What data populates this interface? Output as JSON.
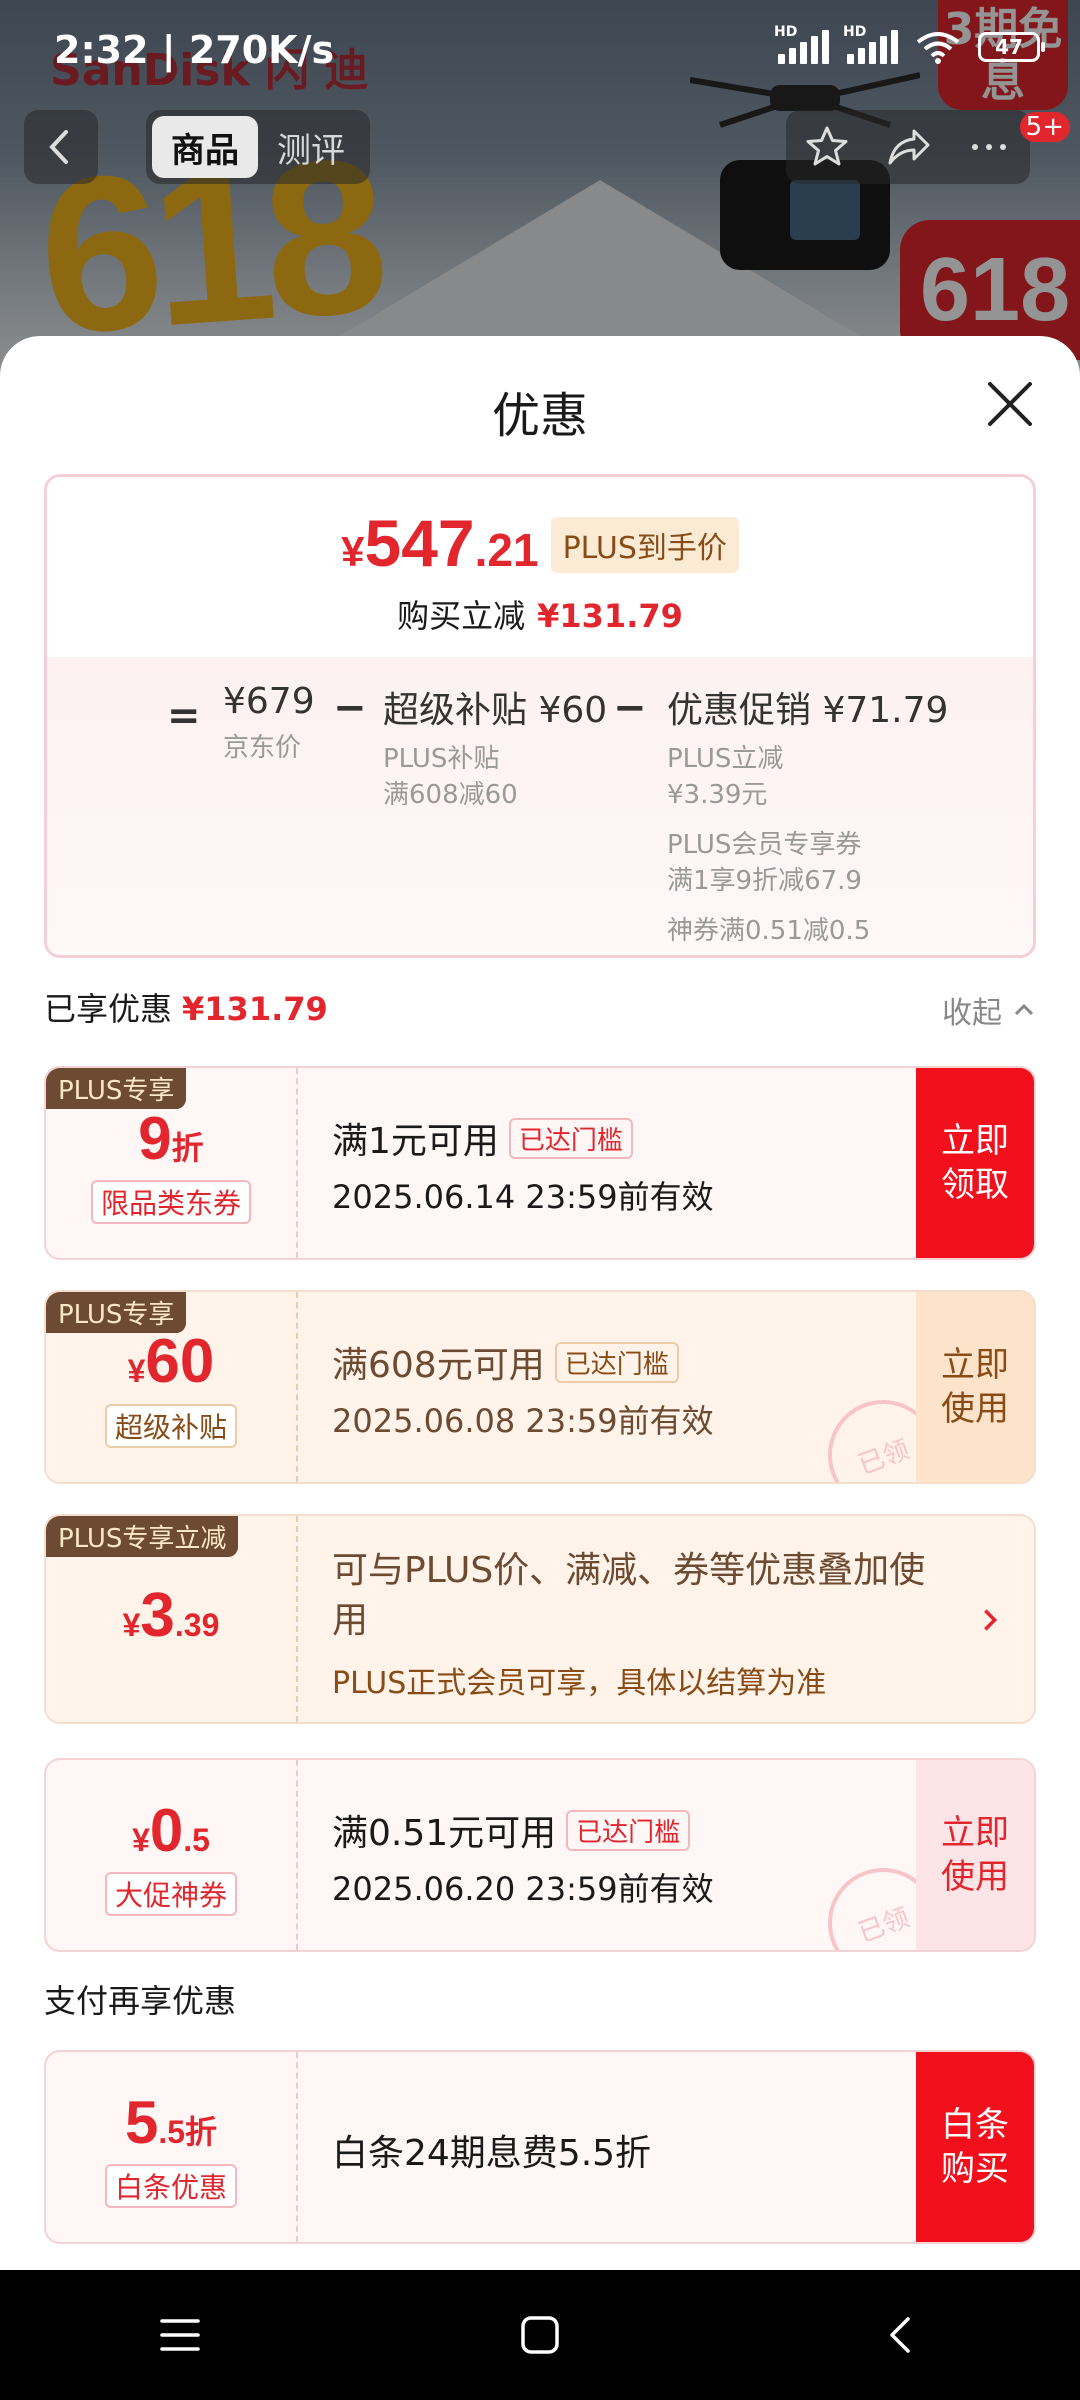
{
  "status_bar": {
    "time": "2:32 | 270K/s",
    "battery": "47",
    "signal_hd": "HD"
  },
  "background": {
    "brand_text": "SanDisk 闪 迪",
    "promo_badge": "3期免息",
    "promo_618": "618",
    "nav_count": "5+"
  },
  "nav": {
    "tabs": [
      "商品",
      "测评"
    ]
  },
  "sheet": {
    "title": "优惠",
    "summary": {
      "price_currency": "¥",
      "price_int": "547",
      "price_dec": ".21",
      "plus_tag": "PLUS到手价",
      "save_label": "购买立减",
      "save_amount": "¥131.79",
      "eq": "=",
      "minus": "−",
      "jd_price": "¥679",
      "jd_label": "京东价",
      "subsidy_title": "超级补贴 ¥60",
      "subsidy_line1": "PLUS补贴",
      "subsidy_line2": "满608减60",
      "promo_title": "优惠促销 ¥71.79",
      "promo_lines": [
        "PLUS立减",
        "¥3.39元",
        "PLUS会员专享券",
        "满1享9折减67.9",
        "神券满0.51减0.5"
      ]
    },
    "enjoyed_label": "已享优惠",
    "enjoyed_amount": "¥131.79",
    "collapse_label": "收起",
    "coupons": [
      {
        "tag": "PLUS专享",
        "big": "9",
        "big_suffix": "折",
        "sub": "限品类东券",
        "cond": "满1元可用",
        "met": "已达门槛",
        "expiry": "2025.06.14 23:59前有效",
        "action": "立即\n领取"
      },
      {
        "tag": "PLUS专享",
        "big_prefix": "¥",
        "big": "60",
        "sub": "超级补贴",
        "cond": "满608元可用",
        "met": "已达门槛",
        "expiry": "2025.06.08 23:59前有效",
        "action": "立即\n使用",
        "stamp": "已领"
      },
      {
        "tag": "PLUS专享立减",
        "big_prefix": "¥",
        "big": "3",
        "big_suffix": ".39",
        "desc": "可与PLUS价、满减、券等优惠叠加使用",
        "note": "PLUS正式会员可享，具体以结算为准"
      },
      {
        "big_prefix": "¥",
        "big": "0",
        "big_suffix": ".5",
        "sub": "大促神券",
        "cond": "满0.51元可用",
        "met": "已达门槛",
        "expiry": "2025.06.20 23:59前有效",
        "action": "立即\n使用",
        "stamp": "已领"
      }
    ],
    "pay_title": "支付再享优惠",
    "pay_coupon": {
      "big": "5",
      "big_suffix": ".5折",
      "sub": "白条优惠",
      "desc": "白条24期息费5.5折",
      "action": "白条\n购买"
    }
  },
  "colors": {
    "accent_red": "#e1262e",
    "plus_brown": "#6d4a32",
    "plus_gold": "#fbe7c6"
  }
}
